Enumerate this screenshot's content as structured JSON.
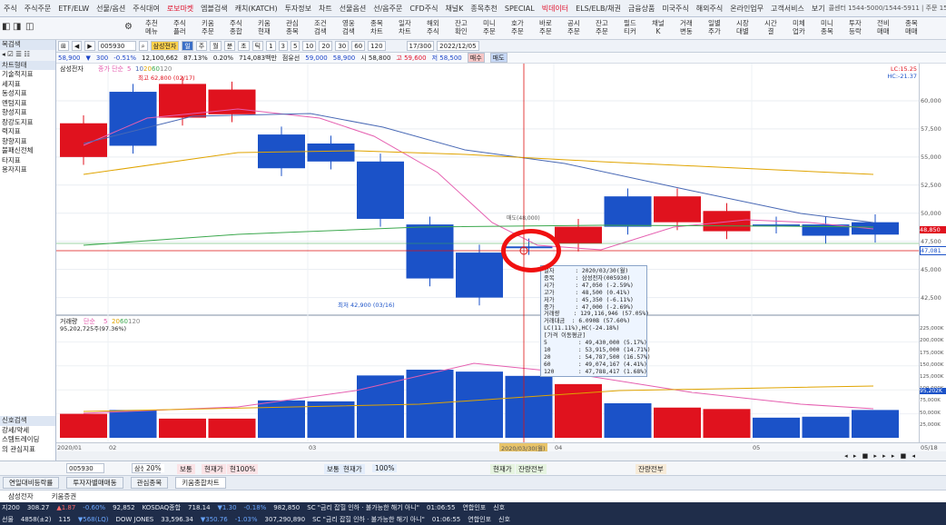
{
  "menu": {
    "items": [
      "주식",
      "주식주문",
      "ETF/ELW",
      "선물/옵션",
      "주식대여",
      "로보마켓",
      "엠블검색",
      "캐치(KATCH)",
      "투자정보",
      "차트",
      "선물옵션",
      "선/옵주문",
      "CFD주식",
      "채널K",
      "종목추천",
      "SPECIAL",
      "빅데이터",
      "ELS/ELB/채권",
      "금융상품",
      "미국주식",
      "해외주식",
      "온라인업무",
      "고객서비스",
      "보기"
    ],
    "right": "콜센터 1544-5000/1544-5911 | 주문 1588-4389 | ARS 1544-9900"
  },
  "toolbar": {
    "buttons": [
      "추천\n메뉴",
      "주식\n플러",
      "키움\n주문",
      "주식\n종합",
      "키움\n현재",
      "관심\n종목",
      "조건\n검색",
      "영웅\n검색",
      "종목\n차트",
      "일자\n차트",
      "해외\n주식",
      "잔고\n확인",
      "미니\n주문",
      "호가\n주문",
      "바로\n주문",
      "공시\n주문",
      "잔고\n주문",
      "필드\n티커",
      "채널\nK",
      "거래\n변동",
      "일별\n주가",
      "시장\n대별",
      "시간\n결",
      "미체\n업카",
      "미니\n종목",
      "투자\n등락",
      "전비\n매매",
      "종목\n매매"
    ]
  },
  "left_panel": {
    "header": "목검색",
    "sub": "차트형태",
    "items": [
      "기술적지표",
      "세지표",
      "동성지표",
      "멘텀지표",
      "향성지표",
      "장강도지표",
      "력지표",
      "향향지표",
      "불패신전체",
      "타지표",
      "용자지표"
    ],
    "bottom": [
      "신호검색",
      "강세/약세",
      "스템트레이딩",
      "의 관심지표"
    ]
  },
  "controls": {
    "code": "005930",
    "name": "삼성전자",
    "periods": [
      "일",
      "주",
      "월",
      "분",
      "초",
      "틱"
    ],
    "minutes": [
      "1",
      "3",
      "5",
      "10",
      "20",
      "30",
      "60",
      "120"
    ],
    "count": "17/300",
    "date": "2022/12/05"
  },
  "info": {
    "price": "58,900",
    "arrow": "▼",
    "change": "300",
    "pct": "-0.51%",
    "volume": "12,100,662",
    "ratio": "87.13%",
    "r2": "0.20%",
    "amount": "714,083백만",
    "maker": "점유선",
    "open_lbl": "59,000",
    "high_lbl": "58,900",
    "o": "시 58,800",
    "h": "고 59,600",
    "l": "저 58,500",
    "buy": "매수",
    "sell": "매도"
  },
  "price_pane": {
    "title": "삼성전자",
    "ma_label": "종가 단순",
    "ma_periods": [
      "5",
      "10",
      "20",
      "60",
      "120"
    ],
    "high_note": "최고 62,800 (02/17)",
    "low_note": "최저 42,900 (03/16)",
    "cross_note": "매도(48,000)",
    "right_top": "LC:15.25",
    "right_hc": "HC:-21.37"
  },
  "price_axis": [
    "60,000",
    "57,500",
    "55,000",
    "52,500",
    "50,000",
    "47,500",
    "45,000",
    "42,500"
  ],
  "price_badges": {
    "a": "48,850",
    "b": "47,081"
  },
  "volume_pane": {
    "title": "거래량",
    "ma_label": "단순",
    "ma_periods": [
      "5",
      "20",
      "60",
      "120"
    ],
    "value": "95,202,725주(97.36%)"
  },
  "volume_axis": [
    "225,000K",
    "200,000K",
    "175,000K",
    "150,000K",
    "125,000K",
    "100,000K",
    "75,000K",
    "50,000K",
    "25,000K"
  ],
  "vol_badge": "95,202K",
  "x_axis": {
    "labels": [
      "2020/01",
      "02",
      "03",
      "04",
      "05"
    ],
    "cursor": "2020/03/30(월)",
    "right": "05/18"
  },
  "tooltip": {
    "lines": [
      "일자      : 2020/03/30(월)",
      "종목      : 삼성전자(005930)",
      "시가      : 47,050 (-2.59%)",
      "고가      : 48,500 (0.41%)",
      "저가      : 45,350 (-6.11%)",
      "종가      : 47,000 (-2.69%)",
      "거래량    : 129,116,946 (57.05%)",
      "거래대금  : 6.090B (57.60%)",
      "LC(11.11%),HC(-24.18%)",
      "[가격 이동평균]",
      "5         : 49,430,000 (5.17%)",
      "10        : 53,915,000 (14.71%)",
      "20        : 54,787,500 (16.57%)",
      "60        : 49,074,167 (4.41%)",
      "120       : 47,788,417 (1.68%)"
    ]
  },
  "bottom1": {
    "code": "005930",
    "name": "삼성전자",
    "tags": [
      "20%",
      "보통",
      "현재가",
      "현100%",
      "보통",
      "현재가",
      "100%",
      "현재가",
      "잔량전부",
      "잔량전부"
    ]
  },
  "bottom2": {
    "items": [
      "연일대비등락률",
      "투자자별매매동",
      "관심종목",
      "키움종합차트"
    ]
  },
  "bottom3": {
    "items": [
      "삼성전자",
      "키움증권"
    ]
  },
  "ticker": {
    "row1": [
      "지200",
      "308.27",
      "▲1.87",
      "-0.60%",
      "92,852",
      "KOSDAQ종합",
      "718.14",
      "▼1.30",
      "-0.18%",
      "982,850",
      "SC \"금리 잡힐 인하 · 불가능한 해기 아니\"",
      "01:06:55",
      "연합인포",
      "신호"
    ],
    "row2": [
      "선물",
      "4858(±2)",
      "115",
      "▼568(LQ)",
      "DOW JONES",
      "33,596.34",
      "▼350.76",
      "-1.03%",
      "307,290,890",
      "SC \"금리 잡힐 인하 · 불가능한 해기 아니\"",
      "01:06:55",
      "연합인포",
      "신호"
    ]
  },
  "chart_data": {
    "type": "candlestick",
    "dates": [
      "2020/01",
      "01",
      "02",
      "02",
      "02",
      "02",
      "03",
      "03",
      "03",
      "03",
      "03",
      "04",
      "04",
      "04",
      "04",
      "05",
      "05",
      "05"
    ],
    "candles": [
      {
        "o": 55000,
        "c": 58000
      },
      {
        "o": 60800,
        "c": 56000
      },
      {
        "o": 58500,
        "c": 61500
      },
      {
        "o": 58800,
        "c": 61000
      },
      {
        "o": 57000,
        "c": 54000
      },
      {
        "o": 56200,
        "c": 54600
      },
      {
        "o": 54600,
        "c": 49500
      },
      {
        "o": 49000,
        "c": 44200
      },
      {
        "o": 46500,
        "c": 42500
      },
      {
        "o": 47050,
        "c": 47000
      },
      {
        "o": 47300,
        "c": 48800
      },
      {
        "o": 51500,
        "c": 48800
      },
      {
        "o": 49200,
        "c": 51500
      },
      {
        "o": 48400,
        "c": 50200
      },
      {
        "o": 49000,
        "c": 48900
      },
      {
        "o": 49000,
        "c": 48000
      },
      {
        "o": 49200,
        "c": 48100
      }
    ],
    "volume_k": [
      50000,
      58000,
      40000,
      40000,
      78000,
      76000,
      130000,
      142000,
      138000,
      129117,
      112000,
      72000,
      63000,
      60000,
      42000,
      44000,
      58000
    ],
    "ylim_price": [
      41500,
      62500
    ],
    "ylim_volume": [
      0,
      250000
    ]
  }
}
